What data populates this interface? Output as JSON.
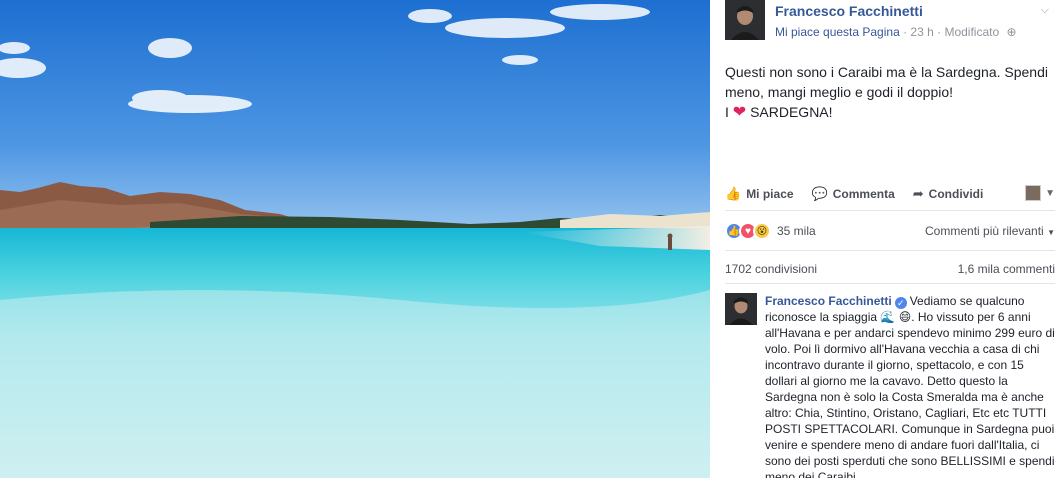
{
  "post": {
    "author": "Francesco Facchinetti",
    "like_page": "Mi piace questa Pagina",
    "sep": " · ",
    "time": "23 h",
    "edited": "Modificato",
    "text_line1": "Questi non sono i Caraibi ma è la Sardegna. Spendi meno, mangi meglio e godi il doppio!",
    "text_line2_prefix": "I ",
    "text_line2_suffix": " SARDEGNA!",
    "heart": "❤"
  },
  "actions": {
    "like": "Mi piace",
    "comment": "Commenta",
    "share": "Condividi"
  },
  "reactions": {
    "count": "35 mila",
    "sort_label": "Commenti più rilevanti",
    "types": [
      "like",
      "love",
      "wow"
    ]
  },
  "stats": {
    "shares": "1702 condivisioni",
    "comments": "1,6 mila commenti"
  },
  "comment": {
    "author": "Francesco Facchinetti",
    "text_a": "Vediamo se qualcuno riconosce la spiaggia ",
    "text_b": ". Ho vissuto per 6 anni all'Havana e per andarci spendevo minimo 299 euro di volo. Poi lì dormivo all'Havana vecchia a casa di chi incontravo durante il giorno, spettacolo, e con 15 dollari al giorno me la cavavo. Detto questo la Sardegna non è solo la Costa Smeralda ma è anche altro: Chia, Stintino, Oristano, Cagliari, Etc etc TUTTI POSTI SPETTACOLARI. Comunque in Sardegna puoi venire e spendere meno di andare fuori dall'Italia, ci sono dei posti sperduti che sono BELLISSIMI e spendi meno dei Caraibi"
  },
  "colors": {
    "link_blue": "#365899",
    "meta_gray": "#90949c",
    "sky": "#2f7ed6",
    "sea": "#3fd0d8"
  }
}
